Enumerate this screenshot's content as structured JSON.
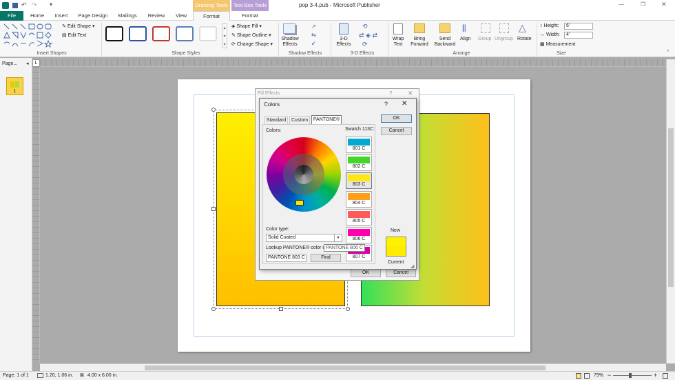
{
  "window": {
    "title": "pop 3-4.pub  -  Microsoft Publisher",
    "contextual_drawing": "Drawing Tools",
    "contextual_textbox": "Text Box Tools"
  },
  "tabs": {
    "file": "File",
    "home": "Home",
    "insert": "Insert",
    "page_design": "Page Design",
    "mailings": "Mailings",
    "review": "Review",
    "view": "View",
    "format1": "Format",
    "format2": "Format"
  },
  "ribbon": {
    "edit_shape": "Edit Shape",
    "edit_text": "Edit Text",
    "insert_shapes": "Insert Shapes",
    "shape_fill": "Shape Fill",
    "shape_outline": "Shape Outline",
    "change_shape": "Change Shape",
    "shape_styles": "Shape Styles",
    "shadow_effects_btn": "Shadow Effects",
    "shadow_effects": "Shadow Effects",
    "three_d_btn": "3-D Effects",
    "three_d": "3-D Effects",
    "wrap_text": "Wrap Text",
    "bring_forward": "Bring Forward",
    "send_backward": "Send Backward",
    "align": "Align",
    "group": "Group",
    "ungroup": "Ungroup",
    "rotate": "Rotate",
    "arrange": "Arrange",
    "height_label": "Height:",
    "height_value": "6'",
    "width_label": "Width:",
    "width_value": "4'",
    "measurement": "Measurement",
    "size": "Size"
  },
  "pages_pane": {
    "label": "Page...",
    "page_number": "1"
  },
  "fill_effects": {
    "title": "Fill Effects",
    "ok": "OK",
    "cancel": "Cancel"
  },
  "colors_dialog": {
    "title": "Colors",
    "help": "?",
    "tab_standard": "Standard",
    "tab_custom": "Custom",
    "tab_pantone": "PANTONE®",
    "colors_label": "Colors:",
    "swatch_label": "Swatch 113C:",
    "color_type_label": "Color type:",
    "color_type_value": "Solid Coated",
    "lookup_label": "Lookup PANTONE® color or",
    "lookup_value": "PANTONE 803 C",
    "find": "Find",
    "tooltip": "PANTONE 806 C",
    "ok": "OK",
    "cancel": "Cancel",
    "new_label": "New",
    "current_label": "Current",
    "new_color": "#fff200",
    "current_color": "#ffec00"
  },
  "swatches": [
    {
      "label": "801 C",
      "color": "#00a9d0"
    },
    {
      "label": "802 C",
      "color": "#44d62c"
    },
    {
      "label": "803 C",
      "color": "#ffe716"
    },
    {
      "label": "804 C",
      "color": "#ff9e1b"
    },
    {
      "label": "805 C",
      "color": "#ff5a5a"
    },
    {
      "label": "806 C",
      "color": "#ff00b0"
    },
    {
      "label": "807 C",
      "color": "#d600a9"
    }
  ],
  "status": {
    "page": "Page: 1 of 1",
    "position": "1.20, 1.06 in.",
    "size": "4.00 x 6.00 in.",
    "zoom": "79%"
  }
}
